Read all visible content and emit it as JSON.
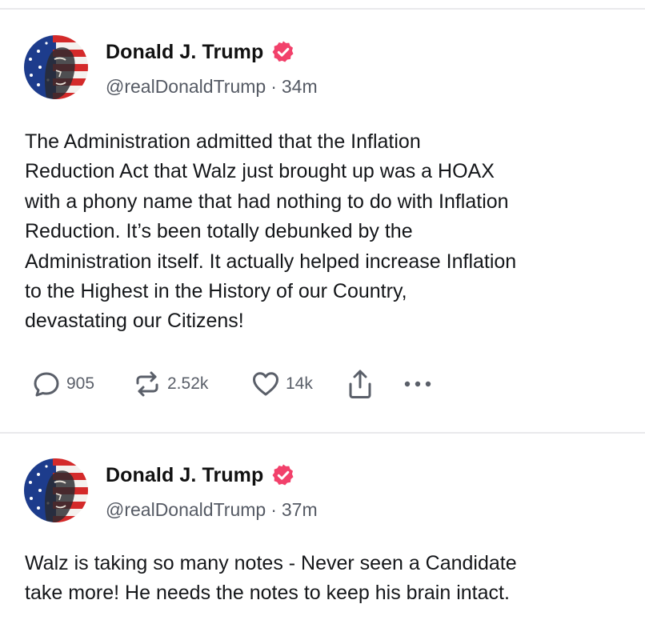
{
  "posts": [
    {
      "display_name": "Donald J. Trump",
      "handle": "@realDonaldTrump",
      "separator": "·",
      "time": "34m",
      "text_lines": [
        "The Administration admitted that the Inflation",
        "Reduction Act that Walz just brought up was a HOAX",
        "with a phony name that had nothing to do with Inflation",
        "Reduction. It’s been totally debunked by the",
        "Administration itself. It actually helped increase Inflation",
        "to the Highest in the History of our Country,",
        "devastating our Citizens!"
      ],
      "actions": {
        "replies": "905",
        "reposts": "2.52k",
        "likes": "14k"
      }
    },
    {
      "display_name": "Donald J. Trump",
      "handle": "@realDonaldTrump",
      "separator": "·",
      "time": "37m",
      "text_lines": [
        "Walz is taking so many notes - Never seen a Candidate",
        "take more! He needs the notes to keep his brain intact."
      ]
    }
  ],
  "icons": {
    "verified": "verified-badge-icon",
    "reply": "reply-bubble-icon",
    "repost": "repost-arrows-icon",
    "like": "heart-icon",
    "share": "share-icon",
    "more": "more-dots-icon"
  },
  "colors": {
    "verified_badge": "#f2416b",
    "action_icon": "#5a5f69",
    "handle_text": "#555a64",
    "divider": "#e9e9ec"
  }
}
